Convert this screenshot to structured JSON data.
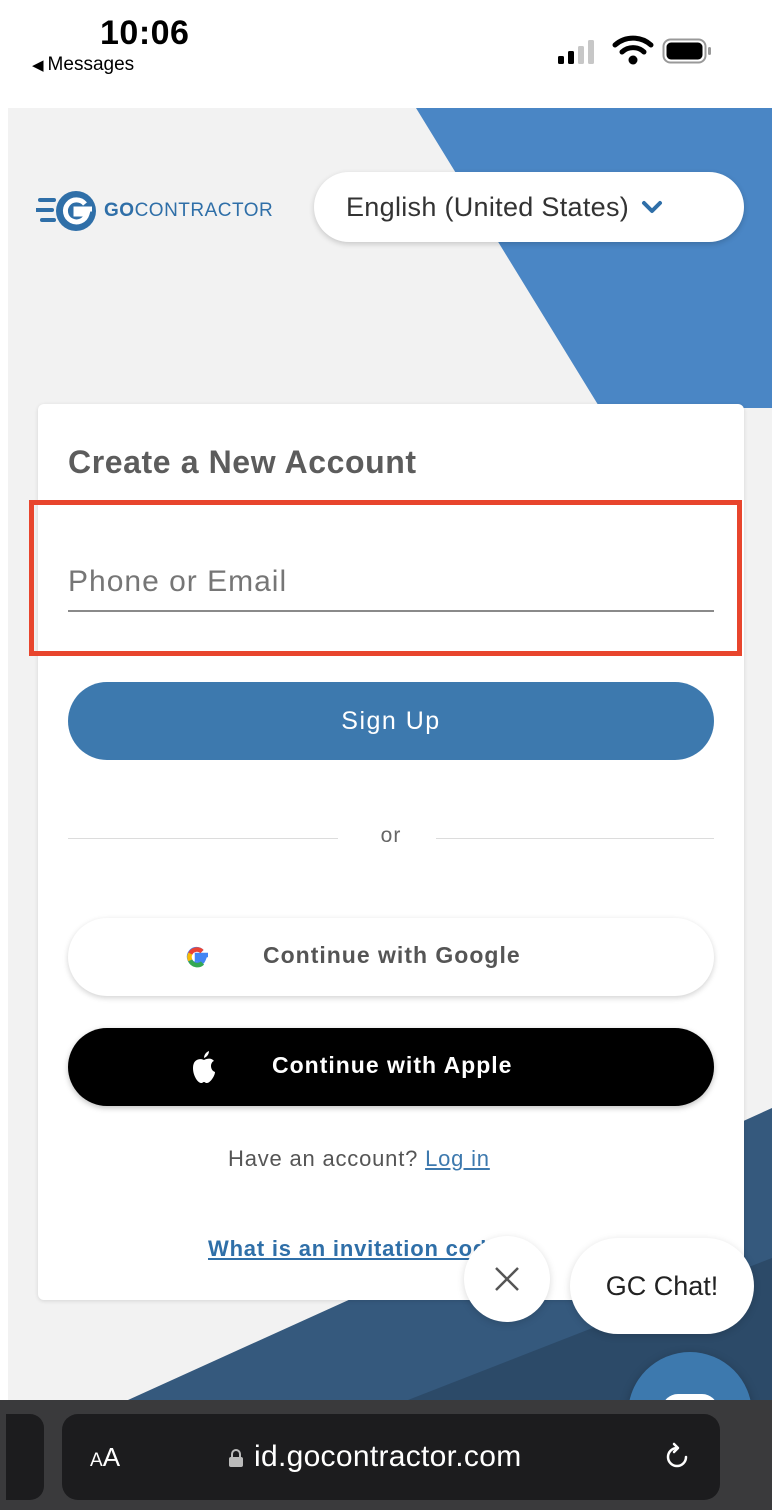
{
  "status_bar": {
    "time": "10:06",
    "back_label": "Messages",
    "back_glyph": "◀"
  },
  "header": {
    "logo_prefix": "GO",
    "logo_suffix": "CONTRACTOR",
    "language_selected": "English (United States)"
  },
  "signup_card": {
    "title": "Create a New Account",
    "phone_email_placeholder": "Phone or Email",
    "phone_email_value": "",
    "signup_label": "Sign Up",
    "divider_text": "or",
    "google_label": "Continue with Google",
    "apple_label": "Continue with Apple",
    "have_account_text": "Have an account?",
    "login_link": "Log in",
    "invitation_link": "What is an invitation code?"
  },
  "chat": {
    "bubble_text": "GC Chat!"
  },
  "browser": {
    "aa_big": "A",
    "aa_small": "A",
    "url": "id.gocontractor.com"
  },
  "colors": {
    "brand_blue": "#3d79ae",
    "highlight_red": "#e8452d",
    "background": "#f2f2f2"
  },
  "icons": [
    "back-triangle-icon",
    "signal-icon",
    "wifi-icon",
    "battery-icon",
    "chevron-down-icon",
    "google-icon",
    "apple-icon",
    "close-icon",
    "chat-icon",
    "lock-icon",
    "reload-icon"
  ]
}
